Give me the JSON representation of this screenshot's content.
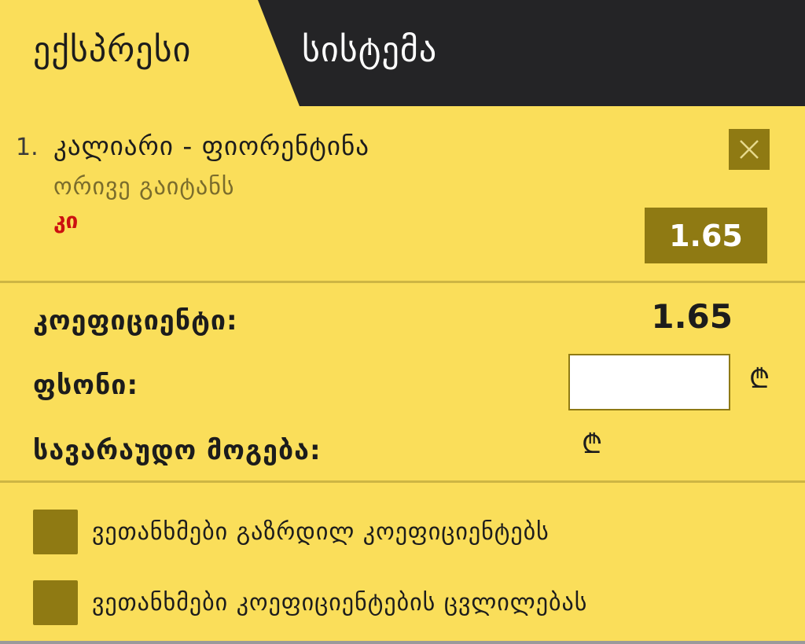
{
  "tabs": {
    "express": "ექსპრესი",
    "system": "სისტემა"
  },
  "bet": {
    "number": "1.",
    "match": "კალიარი - ფიორენტინა",
    "market": "ორივე გაიტანს",
    "outcome": "კი",
    "odds": "1.65",
    "close_icon": "close-icon"
  },
  "summary": {
    "coefficient_label": "კოეფიციენტი:",
    "coefficient_value": "1.65",
    "stake_label": "ფსონი:",
    "stake_value": "",
    "currency_symbol": "₾",
    "possible_win_label": "სავარაუდო მოგება:"
  },
  "options": [
    {
      "label": "ვეთანხმები გაზრდილ კოეფიციენტებს",
      "checked": false
    },
    {
      "label": "ვეთანხმები კოეფიციენტების ცვლილებას",
      "checked": false
    }
  ],
  "colors": {
    "background": "#fade5a",
    "dark": "#242426",
    "accent": "#8f7a13",
    "outcome": "#cc1010"
  }
}
